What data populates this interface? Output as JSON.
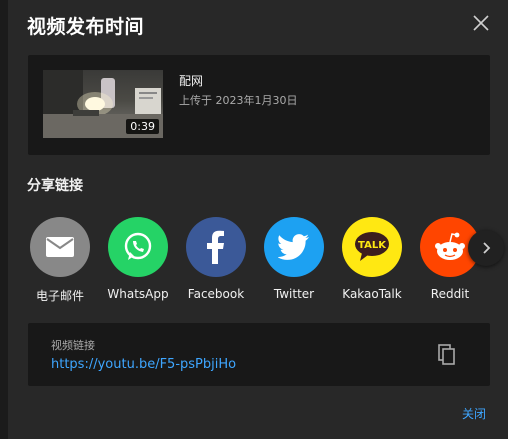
{
  "dialog": {
    "title": "视频发布时间",
    "close_icon": "close-icon"
  },
  "video": {
    "title": "配网",
    "upload_info": "上传于 2023年1月30日",
    "duration": "0:39"
  },
  "share": {
    "heading": "分享链接",
    "items": [
      {
        "label": "电子邮件",
        "icon": "email-icon",
        "color": "#888888"
      },
      {
        "label": "WhatsApp",
        "icon": "whatsapp-icon",
        "color": "#25d366"
      },
      {
        "label": "Facebook",
        "icon": "facebook-icon",
        "color": "#3b5998"
      },
      {
        "label": "Twitter",
        "icon": "twitter-icon",
        "color": "#1da1f2"
      },
      {
        "label": "KakaoTalk",
        "icon": "kakaotalk-icon",
        "color": "#ffe812"
      },
      {
        "label": "Reddit",
        "icon": "reddit-icon",
        "color": "#ff4500"
      }
    ],
    "next_icon": "chevron-right-icon"
  },
  "link": {
    "label": "视频链接",
    "url": "https://youtu.be/F5-psPbjiHo",
    "copy_icon": "copy-icon"
  },
  "footer": {
    "close_label": "关闭"
  },
  "colors": {
    "accent": "#3ea6ff",
    "dialog_bg": "#282828",
    "card_bg": "#181818"
  }
}
